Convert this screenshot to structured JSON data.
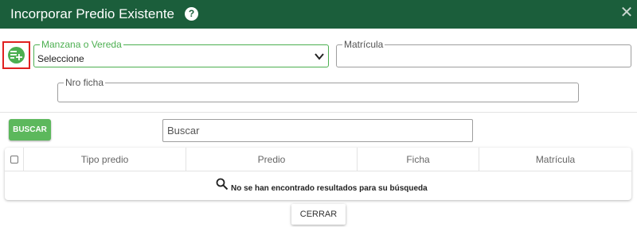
{
  "dialog": {
    "title": "Incorporar Predio Existente",
    "help_icon": "question-circle-icon",
    "close_icon": "close-icon",
    "close_symbol": "✕",
    "help_symbol": "?"
  },
  "form": {
    "add_button_icon": "playlist-add-icon",
    "manzana": {
      "label": "Manzana o Vereda",
      "value": "Seleccione"
    },
    "matricula": {
      "label": "Matrícula",
      "value": ""
    },
    "ficha": {
      "label": "Nro ficha",
      "value": ""
    }
  },
  "search": {
    "button_label": "BUSCAR",
    "placeholder": "Buscar"
  },
  "table": {
    "columns": [
      "Tipo predio",
      "Predio",
      "Ficha",
      "Matrícula"
    ],
    "empty_message": "No se han encontrado resultados para su búsqueda"
  },
  "footer": {
    "close_label": "CERRAR"
  },
  "colors": {
    "header": "#1b5e3b",
    "accent": "#4caf50",
    "highlight_border": "#e02020"
  }
}
